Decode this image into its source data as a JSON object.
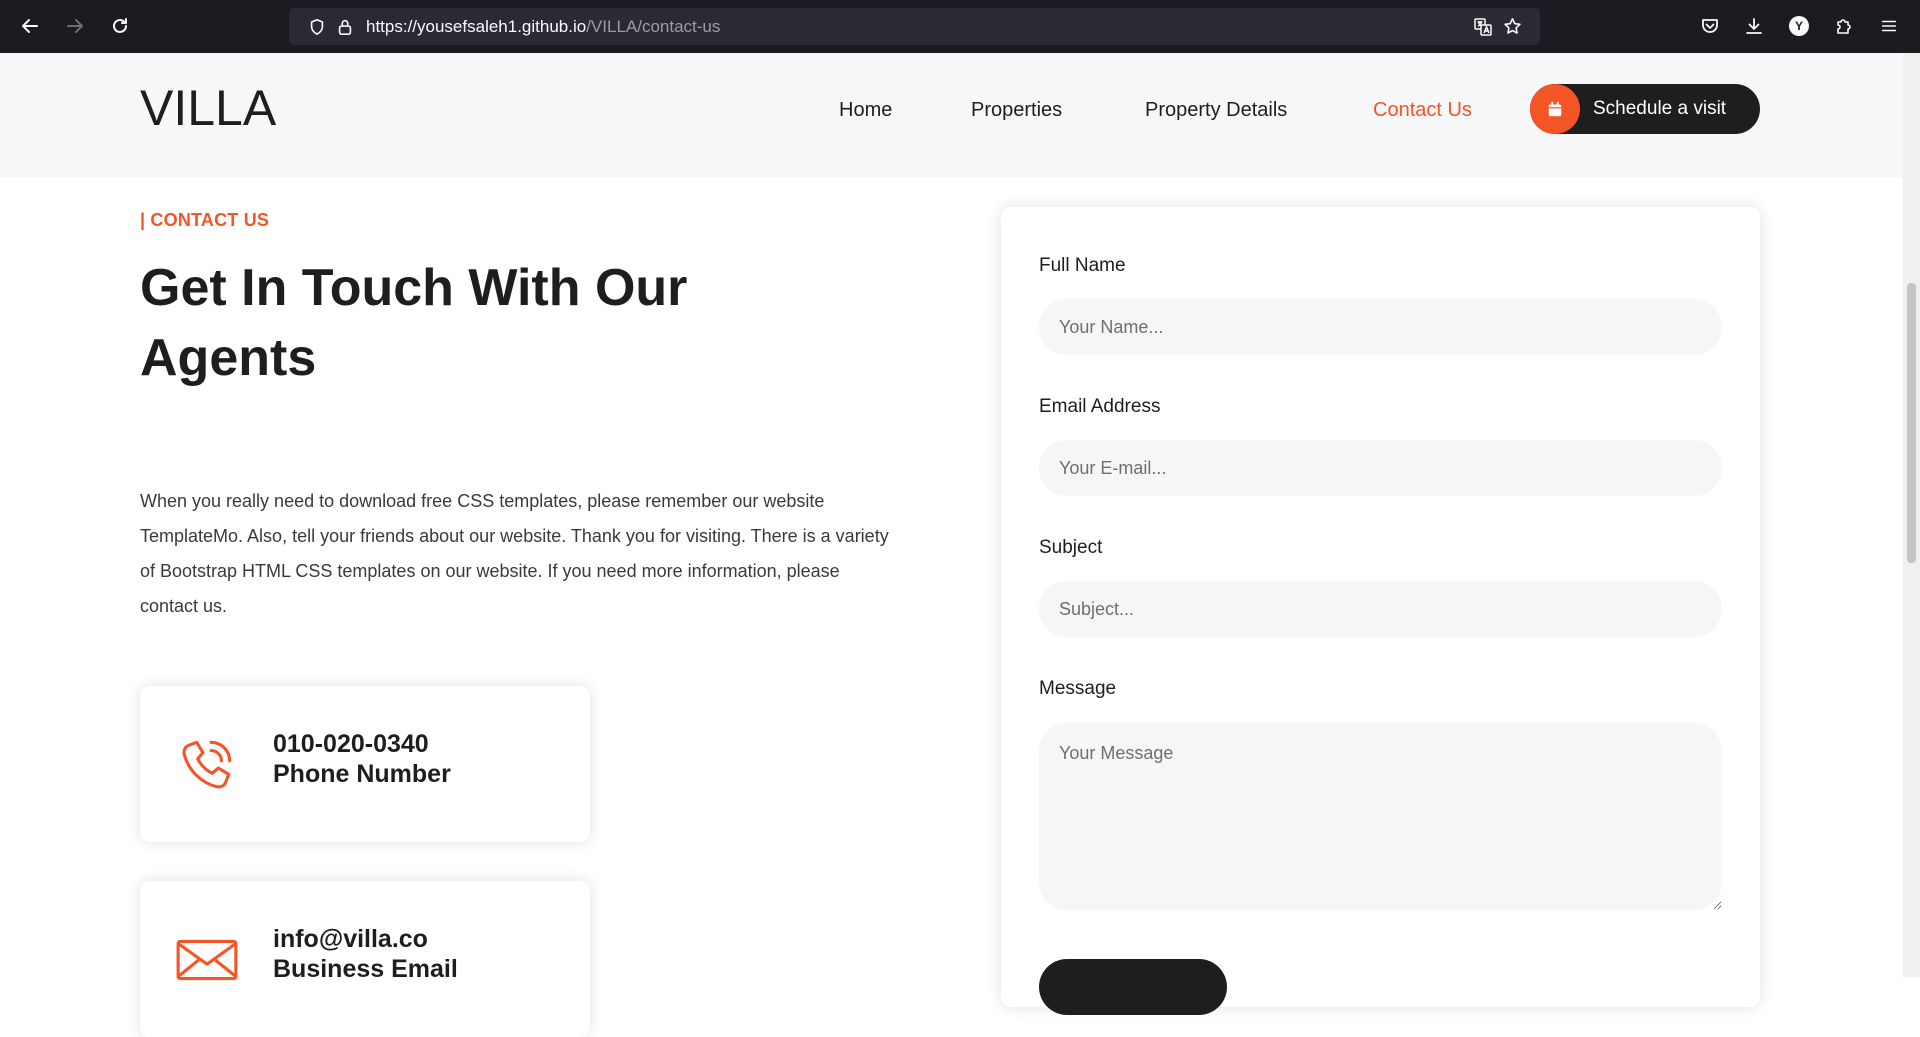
{
  "browser": {
    "url_host": "https://yousefsaleh1.github.io",
    "url_path": "/VILLA/contact-us",
    "profile_initial": "Y"
  },
  "site": {
    "logo": "VILLA",
    "nav": [
      {
        "label": "Home",
        "active": false
      },
      {
        "label": "Properties",
        "active": false
      },
      {
        "label": "Property Details",
        "active": false
      },
      {
        "label": "Contact Us",
        "active": true
      }
    ],
    "schedule_label": "Schedule a visit"
  },
  "contact": {
    "eyebrow": "| CONTACT US",
    "title": "Get In Touch With Our Agents",
    "intro": "When you really need to download free CSS templates, please remember our website TemplateMo. Also, tell your friends about our website. Thank you for visiting. There is a variety of Bootstrap HTML CSS templates on our website. If you need more information, please contact us.",
    "phone": {
      "value": "010-020-0340",
      "caption": "Phone Number"
    },
    "email": {
      "value": "info@villa.co",
      "caption": "Business Email"
    }
  },
  "form": {
    "name_label": "Full Name",
    "name_placeholder": "Your Name...",
    "email_label": "Email Address",
    "email_placeholder": "Your E-mail...",
    "subject_label": "Subject",
    "subject_placeholder": "Subject...",
    "message_label": "Message",
    "message_placeholder": "Your Message"
  },
  "colors": {
    "accent": "#f35525",
    "dark": "#1e1e1e",
    "header_bg": "#f6f7f9",
    "browser_bg": "#1c1b22"
  },
  "icons": {
    "back": "arrow-left-icon",
    "forward": "arrow-right-icon",
    "reload": "reload-icon",
    "tracking": "shield-icon",
    "lock": "lock-icon",
    "translate": "translate-icon",
    "bookmark": "star-icon",
    "pocket": "pocket-icon",
    "downloads": "download-icon",
    "extensions": "puzzle-icon",
    "menu": "hamburger-menu-icon",
    "calendar": "calendar-icon",
    "phone": "phone-icon",
    "email": "envelope-icon"
  }
}
